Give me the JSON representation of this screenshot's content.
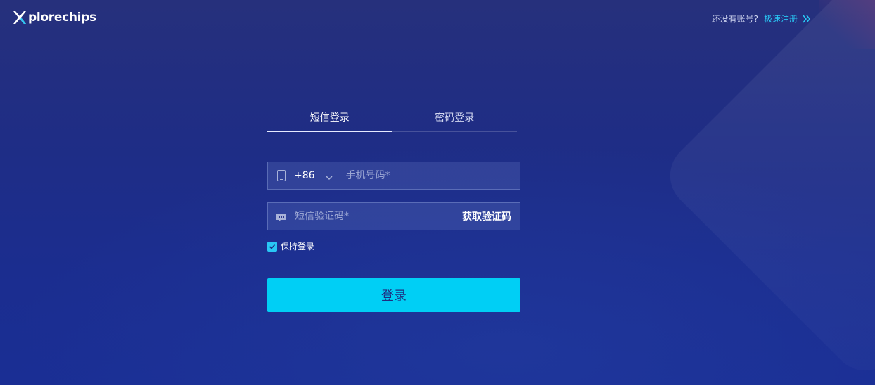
{
  "brand": {
    "logo_text": "plorechips",
    "accent_color": "#29c7f5"
  },
  "header": {
    "no_account_text": "还没有账号?",
    "register_link": "极速注册",
    "register_icon": "double-chevron-right-icon"
  },
  "login": {
    "tabs": [
      {
        "label": "短信登录",
        "active": true
      },
      {
        "label": "密码登录",
        "active": false
      }
    ],
    "phone": {
      "icon": "mobile-phone-icon",
      "country_code": "+86",
      "country_dropdown_icon": "chevron-down-icon",
      "placeholder": "手机号码*",
      "value": ""
    },
    "sms": {
      "icon": "chat-bubble-icon",
      "placeholder": "短信验证码*",
      "value": "",
      "get_code_label": "获取验证码"
    },
    "remember": {
      "checked": true,
      "label": "保持登录"
    },
    "submit_label": "登录",
    "submit_color": "#00cff5"
  }
}
